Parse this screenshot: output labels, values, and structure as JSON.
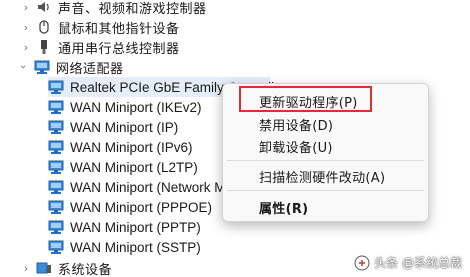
{
  "tree": {
    "audio": {
      "label": "声音、视频和游戏控制器",
      "icon": "speaker-icon"
    },
    "mouse": {
      "label": "鼠标和其他指针设备",
      "icon": "mouse-icon"
    },
    "usb": {
      "label": "通用串行总线控制器",
      "icon": "usb-icon"
    },
    "network": {
      "label": "网络适配器",
      "icon": "network-adapter-icon"
    },
    "adapters": [
      "Realtek PCIe GbE Family Controller",
      "WAN Miniport (IKEv2)",
      "WAN Miniport (IP)",
      "WAN Miniport (IPv6)",
      "WAN Miniport (L2TP)",
      "WAN Miniport (Network Monitor)",
      "WAN Miniport (PPPOE)",
      "WAN Miniport (PPTP)",
      "WAN Miniport (SSTP)"
    ],
    "system": {
      "label": "系统设备",
      "icon": "system-devices-icon"
    }
  },
  "context_menu": {
    "update_driver": "更新驱动程序(P)",
    "disable_device": "禁用设备(D)",
    "uninstall_device": "卸载设备(U)",
    "scan_hardware": "扫描检测硬件改动(A)",
    "properties": "属性(R)"
  },
  "watermark": "头条 @系统总裁",
  "colors": {
    "highlight_box": "#d8322d",
    "selected_row": "#e5eef8",
    "network_icon": "#1f7bd1"
  }
}
